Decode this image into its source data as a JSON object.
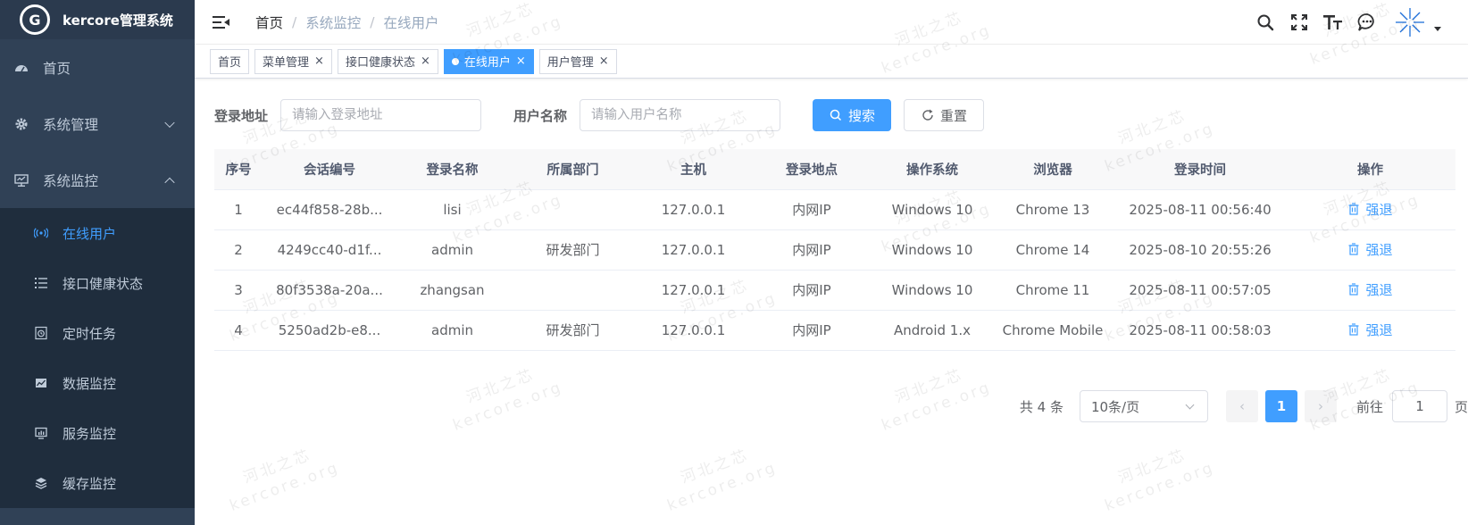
{
  "brand": {
    "logo_letter": "G",
    "title": "kercore管理系统"
  },
  "sidebar": {
    "items": [
      {
        "label": "首页",
        "icon": "dashboard-icon"
      },
      {
        "label": "系统管理",
        "icon": "gear-icon",
        "expanded": false
      },
      {
        "label": "系统监控",
        "icon": "monitor-icon",
        "expanded": true
      }
    ],
    "submenu": [
      {
        "label": "在线用户",
        "icon": "online-icon",
        "active": true
      },
      {
        "label": "接口健康状态",
        "icon": "list-icon"
      },
      {
        "label": "定时任务",
        "icon": "timer-icon"
      },
      {
        "label": "数据监控",
        "icon": "data-icon"
      },
      {
        "label": "服务监控",
        "icon": "server-icon"
      },
      {
        "label": "缓存监控",
        "icon": "cache-icon"
      }
    ]
  },
  "breadcrumb": [
    "首页",
    "系统监控",
    "在线用户"
  ],
  "tags": [
    {
      "label": "首页",
      "closable": false,
      "active": false
    },
    {
      "label": "菜单管理",
      "closable": true,
      "active": false
    },
    {
      "label": "接口健康状态",
      "closable": true,
      "active": false
    },
    {
      "label": "在线用户",
      "closable": true,
      "active": true
    },
    {
      "label": "用户管理",
      "closable": true,
      "active": false
    }
  ],
  "tag_close": "×",
  "search": {
    "ipaddr_label": "登录地址",
    "ipaddr_placeholder": "请输入登录地址",
    "username_label": "用户名称",
    "username_placeholder": "请输入用户名称",
    "search_button": "搜索",
    "reset_button": "重置"
  },
  "table": {
    "columns": [
      "序号",
      "会话编号",
      "登录名称",
      "所属部门",
      "主机",
      "登录地点",
      "操作系统",
      "浏览器",
      "登录时间",
      "操作"
    ],
    "rows": [
      {
        "index": "1",
        "session": "ec44f858-28b...",
        "login": "lisi",
        "dept": "",
        "host": "127.0.0.1",
        "location": "内网IP",
        "os": "Windows 10",
        "browser": "Chrome 13",
        "time": "2025-08-11 00:56:40",
        "action": "强退"
      },
      {
        "index": "2",
        "session": "4249cc40-d1f...",
        "login": "admin",
        "dept": "研发部门",
        "host": "127.0.0.1",
        "location": "内网IP",
        "os": "Windows 10",
        "browser": "Chrome 14",
        "time": "2025-08-10 20:55:26",
        "action": "强退"
      },
      {
        "index": "3",
        "session": "80f3538a-20a...",
        "login": "zhangsan",
        "dept": "",
        "host": "127.0.0.1",
        "location": "内网IP",
        "os": "Windows 10",
        "browser": "Chrome 11",
        "time": "2025-08-11 00:57:05",
        "action": "强退"
      },
      {
        "index": "4",
        "session": "5250ad2b-e8...",
        "login": "admin",
        "dept": "研发部门",
        "host": "127.0.0.1",
        "location": "内网IP",
        "os": "Android 1.x",
        "browser": "Chrome Mobile",
        "time": "2025-08-11 00:58:03",
        "action": "强退"
      }
    ]
  },
  "pagination": {
    "total_text": "共 4 条",
    "page_size": "10条/页",
    "current_page": "1",
    "prev": "‹",
    "next": "›",
    "goto_prefix": "前往",
    "goto_value": "1",
    "goto_suffix": "页"
  },
  "watermark": {
    "line1": "河北之芯",
    "line2": "kercore.org"
  },
  "colors": {
    "sidebar_bg": "#304156",
    "submenu_bg": "#1f2d3d",
    "primary": "#409eff"
  }
}
